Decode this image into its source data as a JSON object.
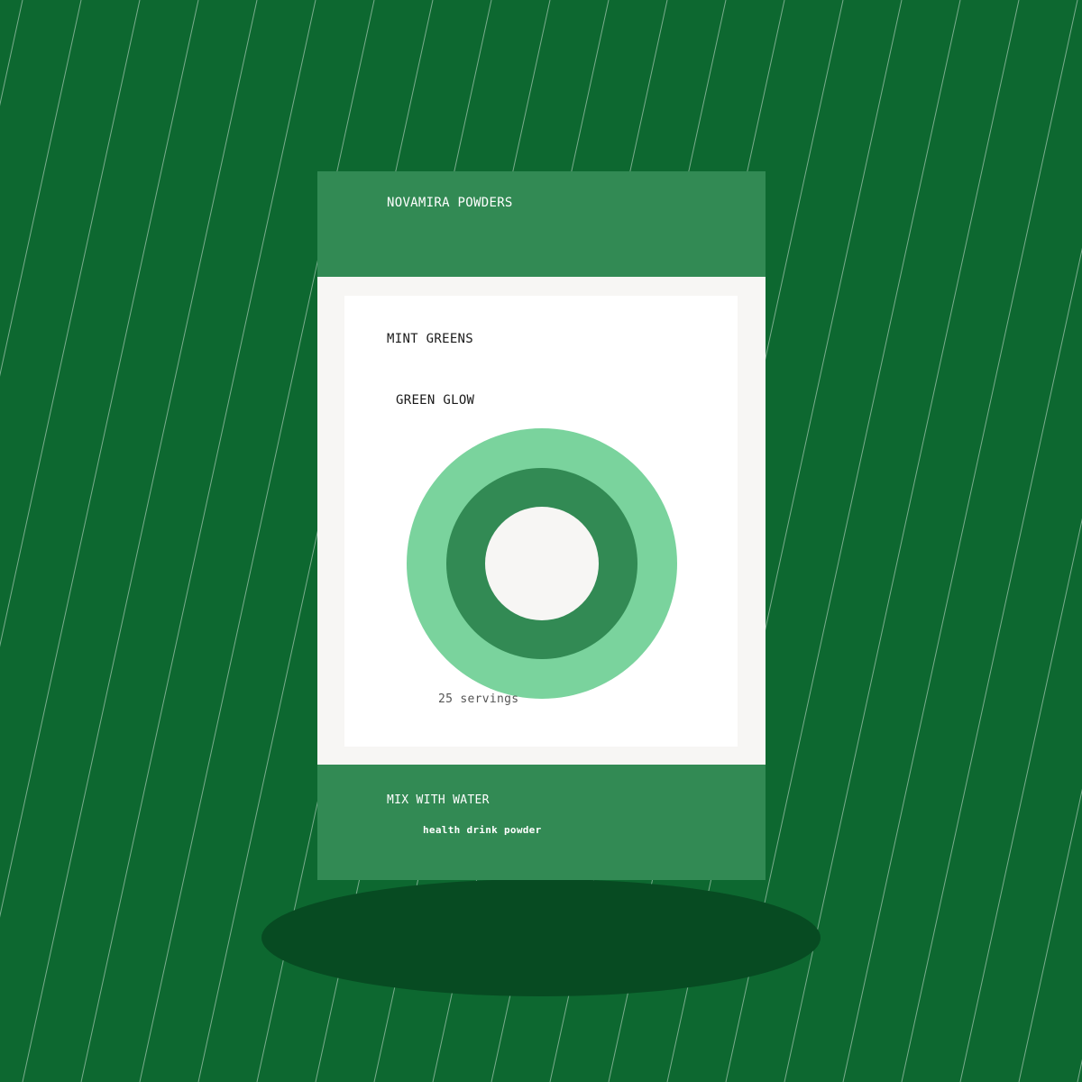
{
  "package": {
    "brand": "NOVAMIRA POWDERS",
    "product_name": "MINT GREENS",
    "flavor": "GREEN GLOW",
    "servings": "25 servings",
    "instructions": "MIX WITH WATER",
    "category": "health drink powder"
  },
  "colors": {
    "background": "#0d6830",
    "band": "#328a54",
    "ring_outer": "#7ad39d",
    "ring_inner": "#328a54",
    "center": "#f7f6f4",
    "shadow": "#074b22"
  }
}
